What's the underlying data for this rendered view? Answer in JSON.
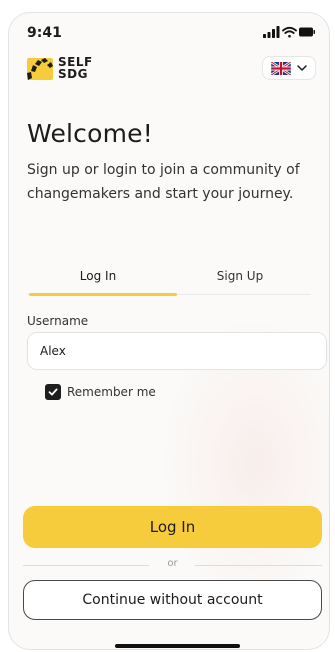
{
  "status_bar": {
    "time": "9:41"
  },
  "brand": {
    "line1": "SELF",
    "line2": "SDG"
  },
  "language": {
    "icon": "uk-flag-icon",
    "chevron": "chevron-down-icon"
  },
  "welcome": {
    "title": "Welcome!",
    "subtitle": "Sign up or login to join a community of changemakers and start your journey."
  },
  "tabs": {
    "login": "Log In",
    "signup": "Sign Up",
    "active": "login"
  },
  "form": {
    "username_label": "Username",
    "username_value": "Alex",
    "remember_label": "Remember me",
    "remember_checked": true
  },
  "actions": {
    "primary": "Log In",
    "divider": "or",
    "secondary": "Continue without account"
  },
  "colors": {
    "accent": "#f6cc3c",
    "text": "#1c1c1c",
    "background": "#fbfaf8"
  }
}
